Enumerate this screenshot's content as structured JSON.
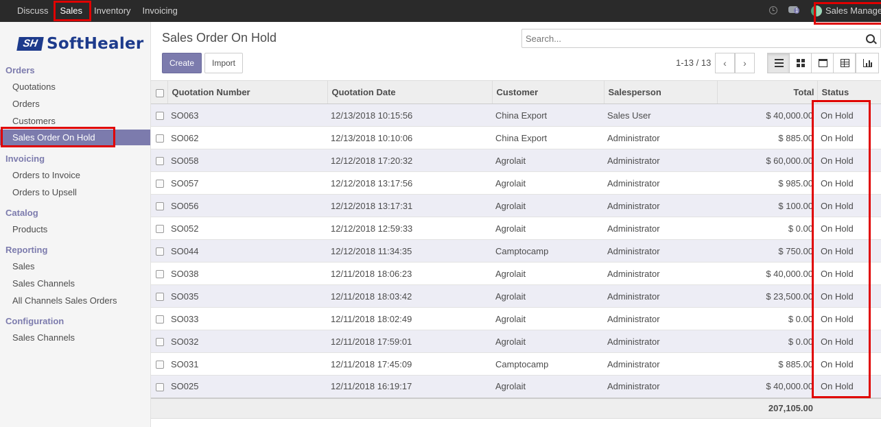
{
  "topbar": {
    "menu": [
      "Discuss",
      "Sales",
      "Inventory",
      "Invoicing"
    ],
    "active": "Sales",
    "chat_count": "1",
    "user_name": "Sales Manager"
  },
  "sidebar": {
    "logo_mark": "SH",
    "logo_text": "SoftHealer",
    "sections": [
      {
        "title": "Orders",
        "items": [
          "Quotations",
          "Orders",
          "Customers",
          "Sales Order On Hold"
        ]
      },
      {
        "title": "Invoicing",
        "items": [
          "Orders to Invoice",
          "Orders to Upsell"
        ]
      },
      {
        "title": "Catalog",
        "items": [
          "Products"
        ]
      },
      {
        "title": "Reporting",
        "items": [
          "Sales",
          "Sales Channels",
          "All Channels Sales Orders"
        ]
      },
      {
        "title": "Configuration",
        "items": [
          "Sales Channels"
        ]
      }
    ],
    "active_item": "Sales Order On Hold"
  },
  "control": {
    "title": "Sales Order On Hold",
    "search_placeholder": "Search...",
    "create_label": "Create",
    "import_label": "Import",
    "pager": "1-13 / 13"
  },
  "table": {
    "columns": [
      "Quotation Number",
      "Quotation Date",
      "Customer",
      "Salesperson",
      "Total",
      "Status"
    ],
    "rows": [
      [
        "SO063",
        "12/13/2018 10:15:56",
        "China Export",
        "Sales User",
        "$ 40,000.00",
        "On Hold"
      ],
      [
        "SO062",
        "12/13/2018 10:10:06",
        "China Export",
        "Administrator",
        "$ 885.00",
        "On Hold"
      ],
      [
        "SO058",
        "12/12/2018 17:20:32",
        "Agrolait",
        "Administrator",
        "$ 60,000.00",
        "On Hold"
      ],
      [
        "SO057",
        "12/12/2018 13:17:56",
        "Agrolait",
        "Administrator",
        "$ 985.00",
        "On Hold"
      ],
      [
        "SO056",
        "12/12/2018 13:17:31",
        "Agrolait",
        "Administrator",
        "$ 100.00",
        "On Hold"
      ],
      [
        "SO052",
        "12/12/2018 12:59:33",
        "Agrolait",
        "Administrator",
        "$ 0.00",
        "On Hold"
      ],
      [
        "SO044",
        "12/12/2018 11:34:35",
        "Camptocamp",
        "Administrator",
        "$ 750.00",
        "On Hold"
      ],
      [
        "SO038",
        "12/11/2018 18:06:23",
        "Agrolait",
        "Administrator",
        "$ 40,000.00",
        "On Hold"
      ],
      [
        "SO035",
        "12/11/2018 18:03:42",
        "Agrolait",
        "Administrator",
        "$ 23,500.00",
        "On Hold"
      ],
      [
        "SO033",
        "12/11/2018 18:02:49",
        "Agrolait",
        "Administrator",
        "$ 0.00",
        "On Hold"
      ],
      [
        "SO032",
        "12/11/2018 17:59:01",
        "Agrolait",
        "Administrator",
        "$ 0.00",
        "On Hold"
      ],
      [
        "SO031",
        "12/11/2018 17:45:09",
        "Camptocamp",
        "Administrator",
        "$ 885.00",
        "On Hold"
      ],
      [
        "SO025",
        "12/11/2018 16:19:17",
        "Agrolait",
        "Administrator",
        "$ 40,000.00",
        "On Hold"
      ]
    ],
    "total": "207,105.00"
  }
}
